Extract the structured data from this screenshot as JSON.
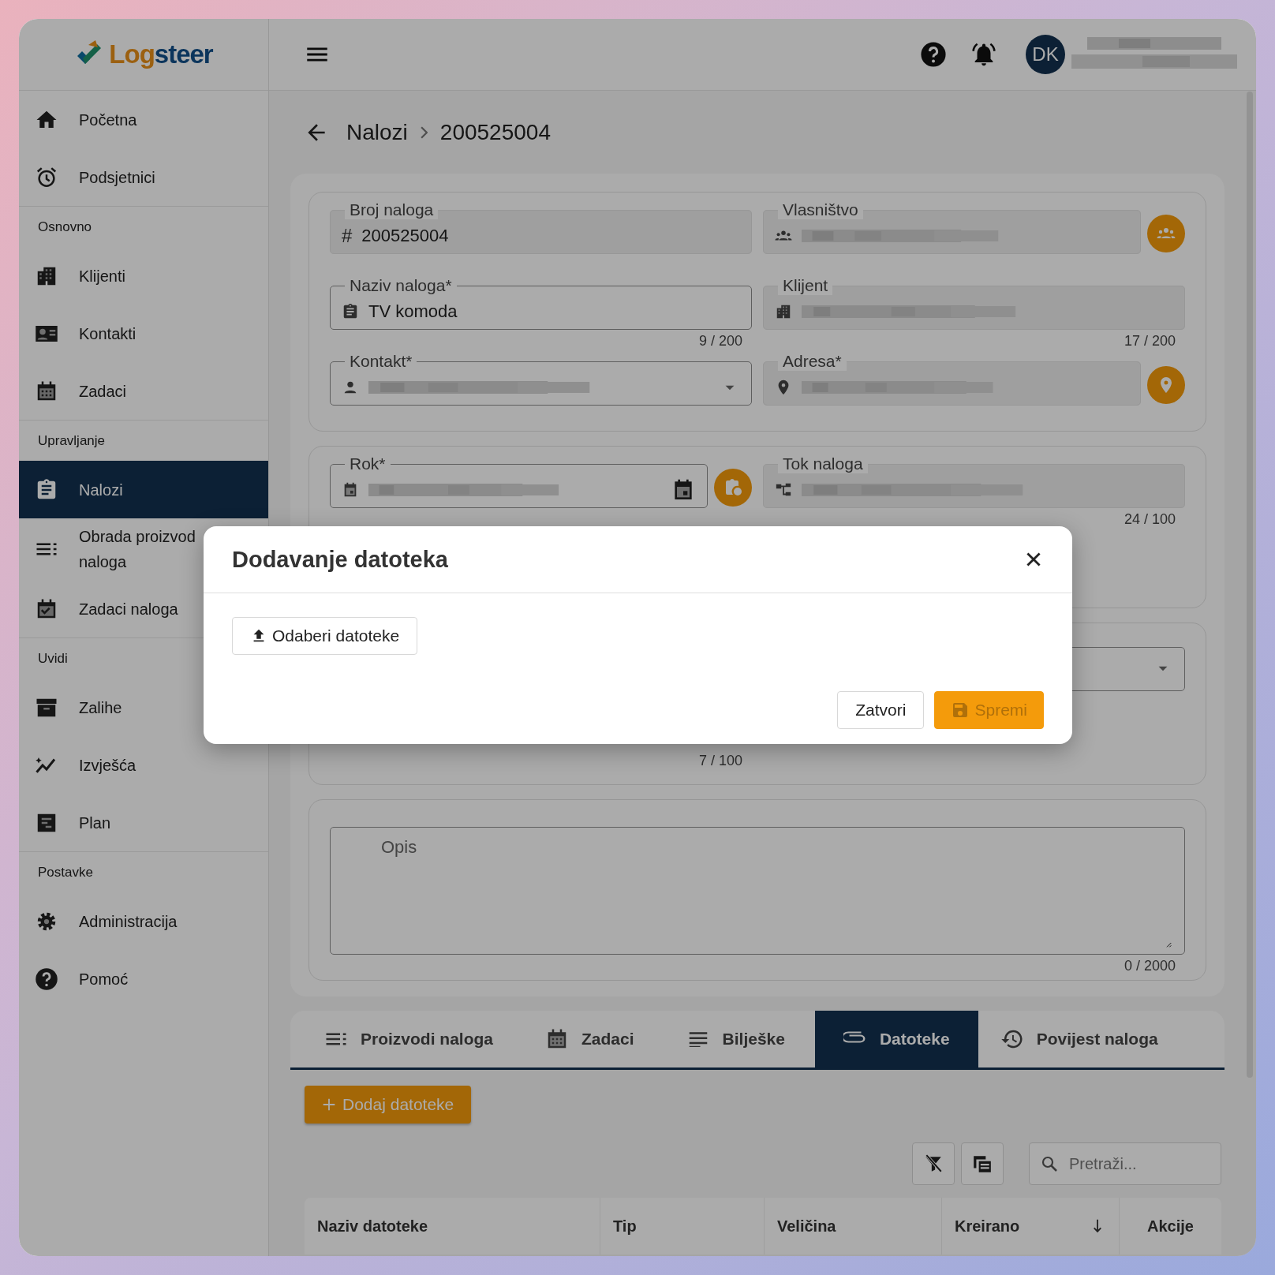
{
  "brand": {
    "prefix": "Log",
    "suffix": "steer"
  },
  "header": {
    "avatar_initials": "DK"
  },
  "sidebar": {
    "items": [
      {
        "kind": "link",
        "label": "Početna",
        "selected": false
      },
      {
        "kind": "link",
        "label": "Podsjetnici",
        "selected": false
      },
      {
        "kind": "section",
        "label": "Osnovno"
      },
      {
        "kind": "link",
        "label": "Klijenti",
        "selected": false
      },
      {
        "kind": "link",
        "label": "Kontakti",
        "selected": false
      },
      {
        "kind": "link",
        "label": "Zadaci",
        "selected": false
      },
      {
        "kind": "section",
        "label": "Upravljanje"
      },
      {
        "kind": "link",
        "label": "Nalozi",
        "selected": true
      },
      {
        "kind": "link",
        "label": "Obrada proizvod naloga",
        "selected": false
      },
      {
        "kind": "link",
        "label": "Zadaci naloga",
        "selected": false
      },
      {
        "kind": "section",
        "label": "Uvidi"
      },
      {
        "kind": "link",
        "label": "Zalihe",
        "selected": false
      },
      {
        "kind": "link",
        "label": "Izvješća",
        "selected": false
      },
      {
        "kind": "link",
        "label": "Plan",
        "selected": false
      },
      {
        "kind": "section",
        "label": "Postavke"
      },
      {
        "kind": "link",
        "label": "Administracija",
        "selected": false
      },
      {
        "kind": "link",
        "label": "Pomoć",
        "selected": false
      }
    ]
  },
  "breadcrumb": [
    "Nalozi",
    "200525004"
  ],
  "form_cards": [
    {
      "fields": [
        {
          "kind": "number",
          "label": "Broj naloga",
          "prefix": "#",
          "value": "200525004",
          "readonly": true
        },
        {
          "kind": "ownership",
          "label": "Vlasništvo",
          "readonly": true,
          "redacted": true,
          "action": true
        },
        {
          "kind": "title",
          "label": "Naziv naloga*",
          "value": "TV komoda",
          "readonly": false,
          "counter": "9 / 200"
        },
        {
          "kind": "client",
          "label": "Klijent",
          "readonly": true,
          "redacted": true,
          "counter": "17 / 200"
        },
        {
          "kind": "contact",
          "label": "Kontakt*",
          "readonly": false,
          "redacted": true
        },
        {
          "kind": "address",
          "label": "Adresa*",
          "readonly": true,
          "redacted": true,
          "action": true
        }
      ]
    },
    {
      "fields": [
        {
          "kind": "date",
          "label": "Rok*",
          "readonly": false,
          "redacted": true,
          "action": true
        },
        {
          "kind": "workflow",
          "label": "Tok naloga",
          "readonly": true,
          "redacted": true,
          "counter": "24 / 100"
        }
      ]
    },
    {
      "fields": [
        {
          "kind": "hidden",
          "counter": "7 / 100"
        },
        {
          "kind": "select",
          "readonly": false
        }
      ]
    },
    {
      "fields": [
        {
          "kind": "textarea",
          "placeholder": "Opis",
          "readonly": false,
          "counter": "0 / 2000"
        }
      ]
    }
  ],
  "tabs": [
    {
      "label": "Proizvodi naloga",
      "selected": false
    },
    {
      "label": "Zadaci",
      "selected": false
    },
    {
      "label": "Bilješke",
      "selected": false
    },
    {
      "label": "Datoteke",
      "selected": true
    },
    {
      "label": "Povijest naloga",
      "selected": false
    }
  ],
  "add_button": "Dodaj datoteke",
  "search": {
    "placeholder": "Pretraži..."
  },
  "table": {
    "columns": [
      {
        "label": "Naziv datoteke",
        "kind": "data",
        "sorted": false
      },
      {
        "label": "Tip",
        "kind": "data",
        "sorted": false
      },
      {
        "label": "Veličina",
        "kind": "data",
        "sorted": false
      },
      {
        "label": "Kreirano",
        "kind": "data",
        "sorted": true
      },
      {
        "label": "Akcije",
        "kind": "actions",
        "sorted": false
      }
    ]
  },
  "modal": {
    "title": "Dodavanje datoteka",
    "pick_button": "Odaberi datoteke",
    "buttons": [
      {
        "label": "Zatvori",
        "kind": "secondary",
        "disabled": false
      },
      {
        "label": "Spremi",
        "kind": "primary",
        "disabled": true
      }
    ]
  }
}
